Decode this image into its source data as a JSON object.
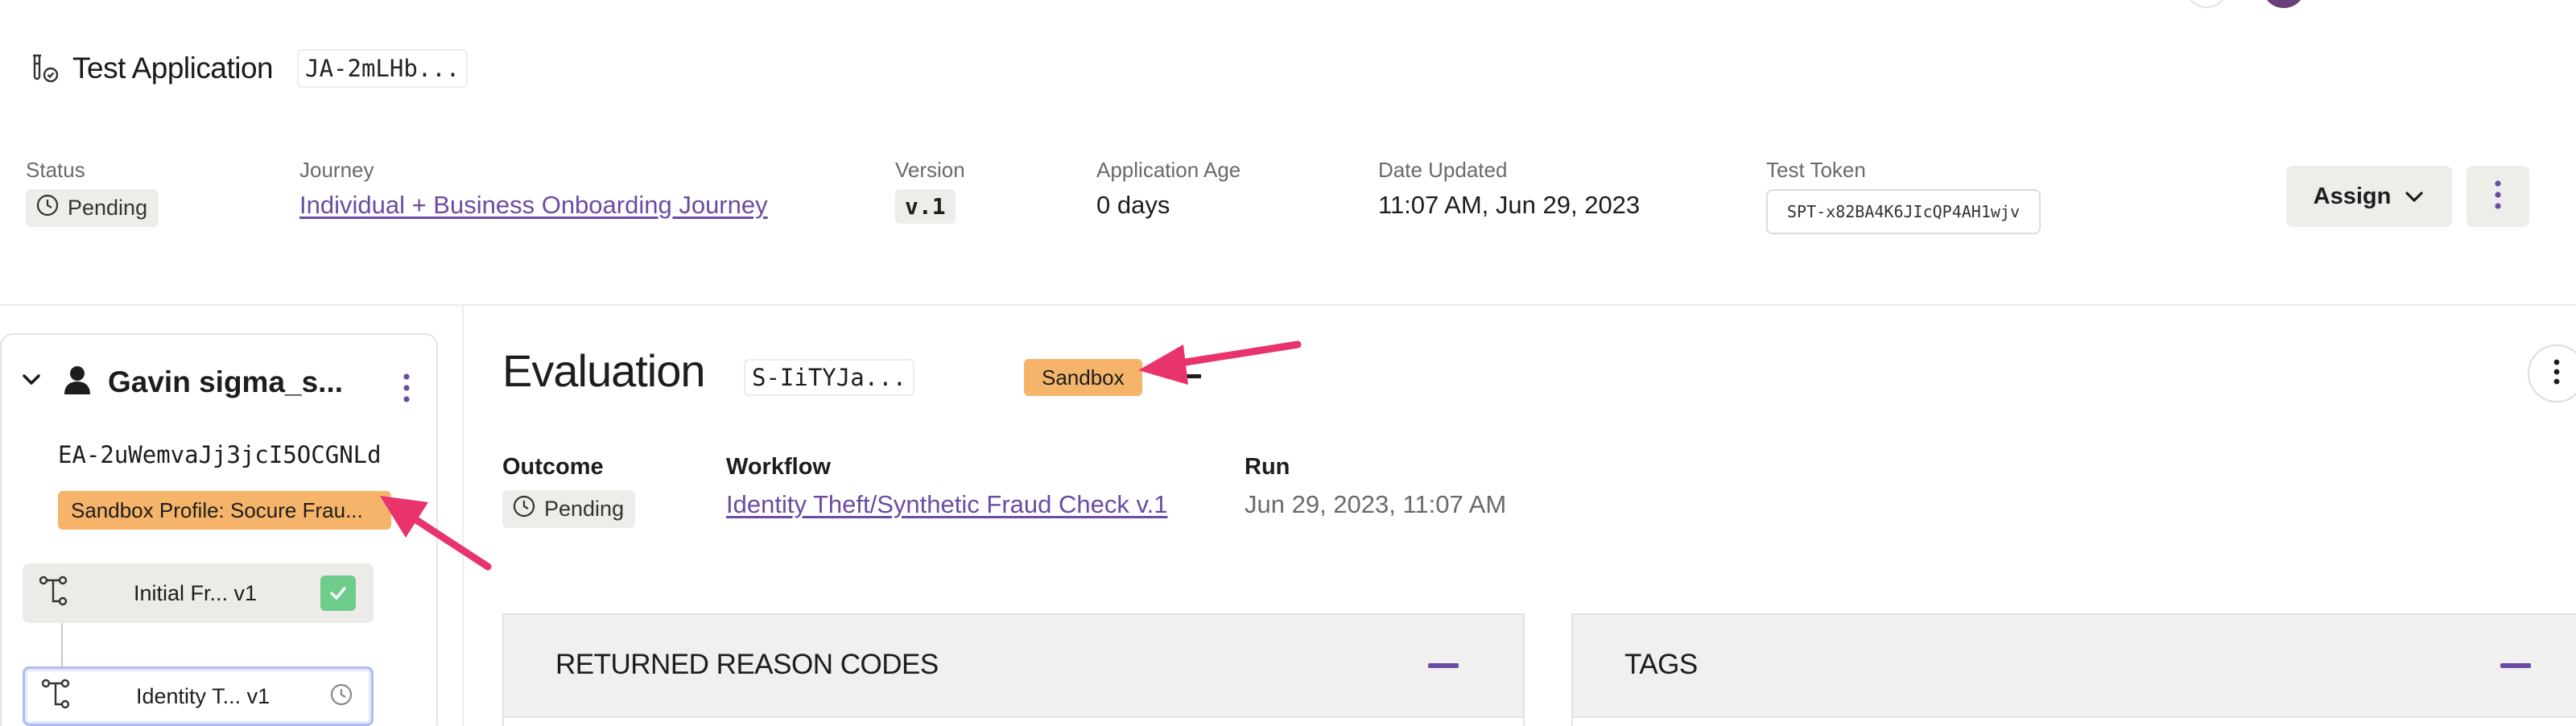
{
  "header": {
    "title": "Test Application",
    "app_id": "JA-2mLHb..."
  },
  "meta": {
    "status": {
      "label": "Status",
      "value": "Pending"
    },
    "journey": {
      "label": "Journey",
      "value": "Individual + Business Onboarding Journey"
    },
    "version": {
      "label": "Version",
      "value": "v.1"
    },
    "age": {
      "label": "Application Age",
      "value": "0 days"
    },
    "updated": {
      "label": "Date Updated",
      "value": "11:07 AM, Jun 29, 2023"
    },
    "token": {
      "label": "Test Token",
      "value": "SPT-x82BA4K6JIcQP4AH1wjv"
    }
  },
  "actions": {
    "assign_label": "Assign"
  },
  "profile": {
    "name": "Gavin sigma_s...",
    "entity_id": "EA-2uWemvaJj3jcI5OCGNLd",
    "sandbox_profile": "Sandbox Profile: Socure Frau...",
    "steps": [
      {
        "label": "Initial Fr... v1",
        "state": "complete"
      },
      {
        "label": "Identity T... v1",
        "state": "pending"
      }
    ]
  },
  "evaluation": {
    "title": "Evaluation",
    "id": "S-IiTYJa...",
    "badge": "Sandbox",
    "outcome": {
      "label": "Outcome",
      "value": "Pending"
    },
    "workflow": {
      "label": "Workflow",
      "value": "Identity Theft/Synthetic Fraud Check v.1"
    },
    "run": {
      "label": "Run",
      "value": "Jun 29, 2023, 11:07 AM"
    }
  },
  "sections": {
    "reason_codes": "RETURNED REASON CODES",
    "tags": "TAGS"
  },
  "colors": {
    "accent": "#6b4ba3",
    "sandbox": "#f5b469",
    "annotation_arrow": "#e8336d",
    "success": "#6fcd8c"
  }
}
